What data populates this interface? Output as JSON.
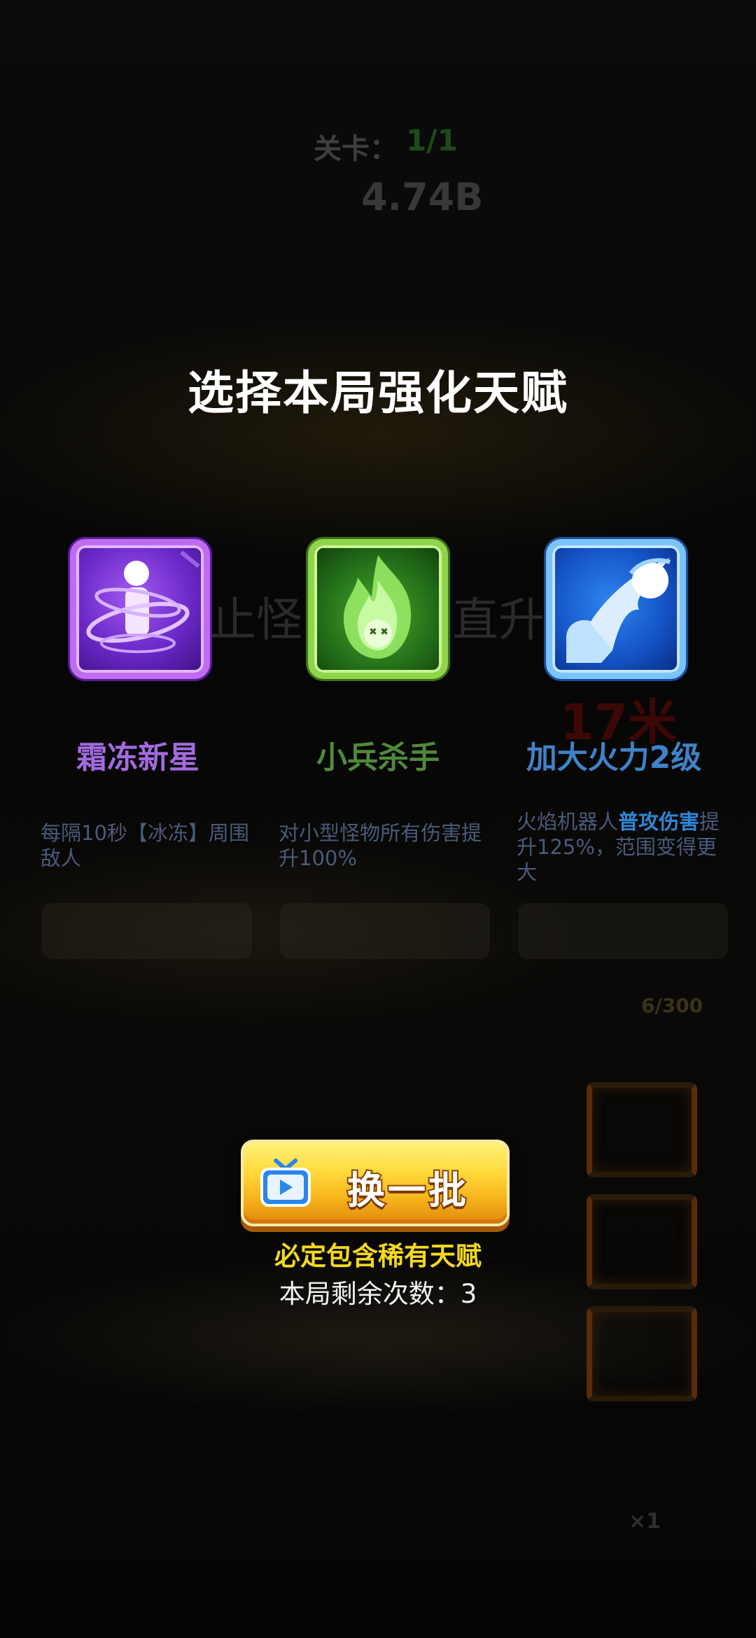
{
  "hud": {
    "stage_label": "关卡：",
    "stage_value": "1/1",
    "power_value": "4.74B",
    "bg_text_left": "止怪",
    "bg_text_right": "直升",
    "distance": "17米",
    "progress": "6/300",
    "multiplier": "×1"
  },
  "title": "选择本局强化天赋",
  "talents": [
    {
      "name": "霜冻新星",
      "icon": "frost-nova-icon",
      "frame_color": "#c06cf0",
      "description": "每隔10秒【冰冻】周围敌人"
    },
    {
      "name": "小兵杀手",
      "icon": "minion-killer-icon",
      "frame_color": "#8fd54a",
      "description": "对小型怪物所有伤害提升100%"
    },
    {
      "name": "加大火力2级",
      "icon": "firepower-icon",
      "frame_color": "#7cc3f8",
      "description_prefix": "火焰机器人",
      "description_highlight": "普攻伤害",
      "description_suffix": "提升125%，范围变得更大"
    }
  ],
  "refresh": {
    "label": "换一批",
    "icon": "tv-ad-icon",
    "guarantee": "必定包含稀有天赋",
    "remaining": "本局剩余次数：3"
  }
}
